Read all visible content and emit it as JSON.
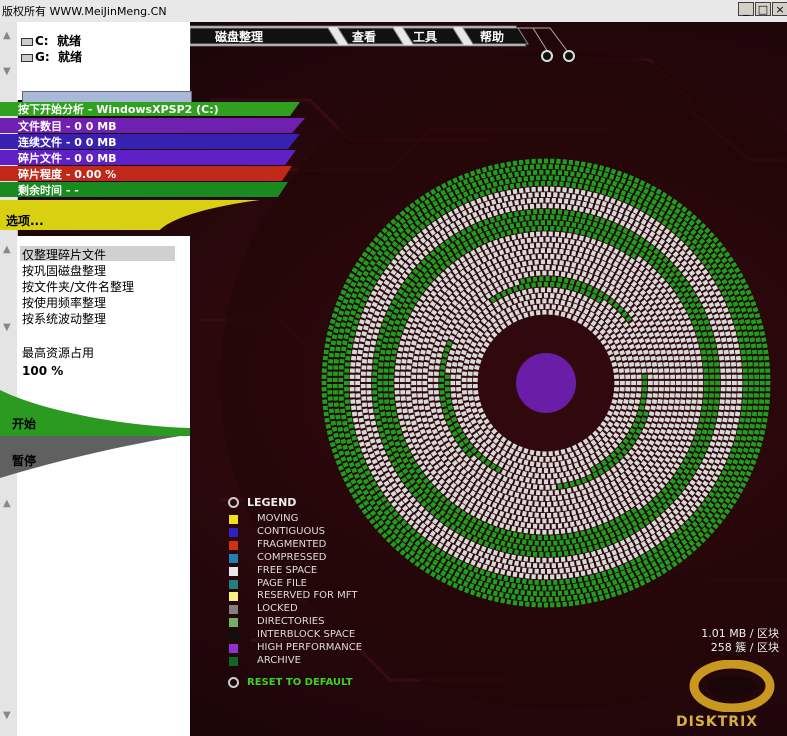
{
  "watermark": "版权所有 WWW.MeiJinMeng.CN",
  "window_buttons": [
    "_",
    "□",
    "×"
  ],
  "menu": [
    "磁盘整理",
    "查看",
    "工具",
    "帮助"
  ],
  "drives": [
    {
      "letter": "C:",
      "status": "就绪"
    },
    {
      "letter": "G:",
      "status": "就绪"
    }
  ],
  "stats": {
    "analyze": "按下开始分析 - WindowsXPSP2 (C:)",
    "file_count": "文件数目 - 0        0 MB",
    "contiguous": "连续文件 - 0        0 MB",
    "fragmented": "碎片文件 - 0        0 MB",
    "frag_level": "碎片程度 - 0.00 %",
    "time_left": "剩余时间      - -"
  },
  "options_label": "选项...",
  "options": [
    "仅整理碎片文件",
    "按巩固磁盘整理",
    "按文件夹/文件名整理",
    "按使用频率整理",
    "按系统波动整理"
  ],
  "resource_label": "最高资源占用",
  "resource_value": "100 %",
  "start_label": "开始",
  "pause_label": "暂停",
  "legend_title": "LEGEND",
  "legend": [
    {
      "label": "MOVING",
      "color": "#f0e020"
    },
    {
      "label": "CONTIGUOUS",
      "color": "#3020c0"
    },
    {
      "label": "FRAGMENTED",
      "color": "#d03018"
    },
    {
      "label": "COMPRESSED",
      "color": "#2080b0"
    },
    {
      "label": "FREE SPACE",
      "color": "#e8e8e8"
    },
    {
      "label": "PAGE FILE",
      "color": "#208080"
    },
    {
      "label": "RESERVED FOR MFT",
      "color": "#f8f080"
    },
    {
      "label": "LOCKED",
      "color": "#808080"
    },
    {
      "label": "DIRECTORIES",
      "color": "#70b060"
    },
    {
      "label": "INTERBLOCK SPACE",
      "color": "#101010"
    },
    {
      "label": "HIGH PERFORMANCE",
      "color": "#9030d0"
    },
    {
      "label": "ARCHIVE",
      "color": "#106820"
    }
  ],
  "reset_label": "RESET TO DEFAULT",
  "cluster_info": [
    "1.01 MB / 区块",
    "258 簇 / 区块"
  ],
  "brand": "DISKTRIX",
  "disk_map": {
    "used_color": "#1e9e1e",
    "free_color": "#d8d8d8"
  }
}
